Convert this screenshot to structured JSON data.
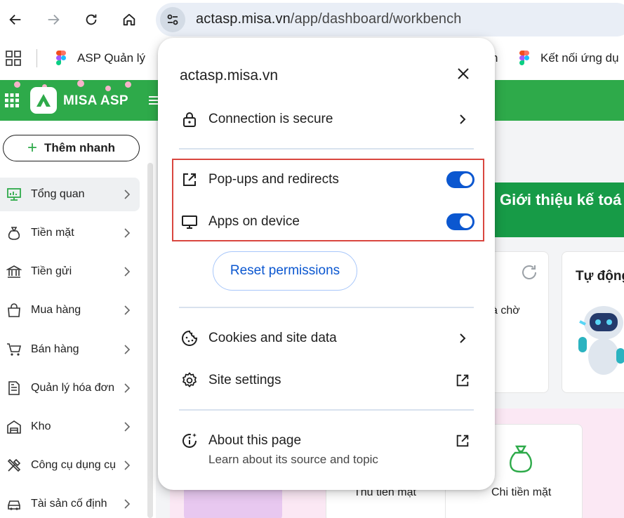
{
  "browser": {
    "url_host": "actasp.misa.vn",
    "url_path": "/app/dashboard/workbench",
    "icons": [
      "back-icon",
      "forward-icon",
      "reload-icon",
      "home-icon",
      "site-info-icon"
    ]
  },
  "bookmarks": {
    "items": [
      {
        "label": "ASP Quản lý"
      },
      {
        "label": "n"
      },
      {
        "label": "Kết nối ứng dụ"
      }
    ]
  },
  "app": {
    "logo_text": "MISA ASP",
    "brand_color": "#2eaa4a",
    "quick_add_label": "Thêm nhanh"
  },
  "sidebar": {
    "items": [
      {
        "label": "Tổng quan",
        "icon": "dashboard-icon",
        "active": true
      },
      {
        "label": "Tiền mặt",
        "icon": "money-bag-icon"
      },
      {
        "label": "Tiền gửi",
        "icon": "bank-icon"
      },
      {
        "label": "Mua hàng",
        "icon": "shopping-bag-icon"
      },
      {
        "label": "Bán hàng",
        "icon": "cart-icon"
      },
      {
        "label": "Quản lý hóa đơn",
        "icon": "invoice-icon"
      },
      {
        "label": "Kho",
        "icon": "warehouse-icon"
      },
      {
        "label": "Công cụ dụng cụ",
        "icon": "tools-icon"
      },
      {
        "label": "Tài sản cố định",
        "icon": "car-icon"
      }
    ]
  },
  "main": {
    "banner_text": "Giới thiệu kế toá",
    "card_partial": "và chờ",
    "card_title": "Tự động",
    "tile1": "Thu tiền mặt",
    "tile2": "Chi tiền mặt"
  },
  "popup": {
    "title": "actasp.misa.vn",
    "connection": "Connection is secure",
    "popups": "Pop-ups and redirects",
    "popups_enabled": true,
    "apps": "Apps on device",
    "apps_enabled": true,
    "reset": "Reset permissions",
    "cookies": "Cookies and site data",
    "site_settings": "Site settings",
    "about": "About this page",
    "about_sub": "Learn about its source and topic",
    "accent_color": "#0b57d0",
    "highlight_color": "#d9463f"
  }
}
